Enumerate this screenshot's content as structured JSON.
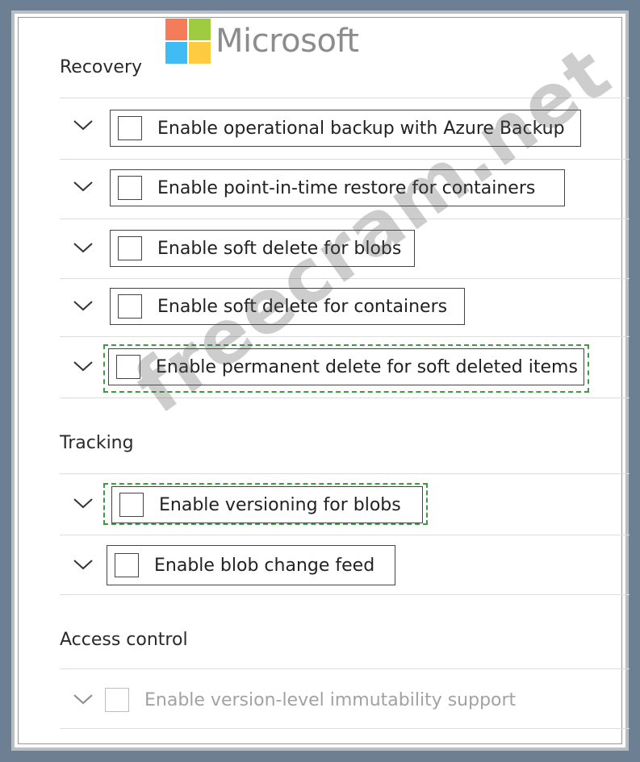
{
  "logo": {
    "text": "Microsoft",
    "colors": [
      "#f25022",
      "#7fba00",
      "#00a4ef",
      "#ffb900"
    ]
  },
  "sections": {
    "recovery": {
      "title": "Recovery",
      "items": [
        {
          "label": "Enable operational backup with Azure Backup",
          "checked": false,
          "highlighted": false,
          "disabled": false
        },
        {
          "label": "Enable point-in-time restore for containers",
          "checked": false,
          "highlighted": false,
          "disabled": false
        },
        {
          "label": "Enable soft delete for blobs",
          "checked": false,
          "highlighted": false,
          "disabled": false
        },
        {
          "label": "Enable soft delete for containers",
          "checked": false,
          "highlighted": false,
          "disabled": false
        },
        {
          "label": "Enable permanent delete for soft deleted items",
          "checked": false,
          "highlighted": true,
          "disabled": false
        }
      ]
    },
    "tracking": {
      "title": "Tracking",
      "items": [
        {
          "label": "Enable versioning for blobs",
          "checked": false,
          "highlighted": true,
          "disabled": false
        },
        {
          "label": "Enable blob change feed",
          "checked": false,
          "highlighted": false,
          "disabled": false
        }
      ]
    },
    "access_control": {
      "title": "Access control",
      "items": [
        {
          "label": "Enable version-level immutability support",
          "checked": false,
          "highlighted": false,
          "disabled": true
        }
      ]
    }
  },
  "watermark": "freecram.net",
  "colors": {
    "highlight_dash": "#3d9b44",
    "background": "#6d7f93"
  }
}
